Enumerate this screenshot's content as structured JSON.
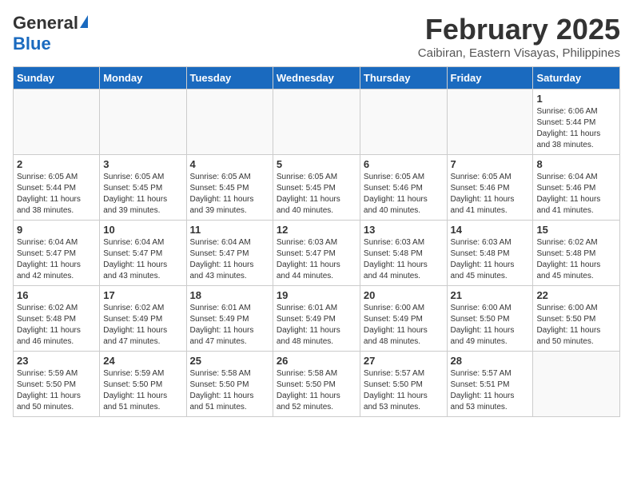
{
  "header": {
    "logo_general": "General",
    "logo_blue": "Blue",
    "month_year": "February 2025",
    "location": "Caibiran, Eastern Visayas, Philippines"
  },
  "days_of_week": [
    "Sunday",
    "Monday",
    "Tuesday",
    "Wednesday",
    "Thursday",
    "Friday",
    "Saturday"
  ],
  "weeks": [
    [
      {
        "day": "",
        "info": ""
      },
      {
        "day": "",
        "info": ""
      },
      {
        "day": "",
        "info": ""
      },
      {
        "day": "",
        "info": ""
      },
      {
        "day": "",
        "info": ""
      },
      {
        "day": "",
        "info": ""
      },
      {
        "day": "1",
        "info": "Sunrise: 6:06 AM\nSunset: 5:44 PM\nDaylight: 11 hours\nand 38 minutes."
      }
    ],
    [
      {
        "day": "2",
        "info": "Sunrise: 6:05 AM\nSunset: 5:44 PM\nDaylight: 11 hours\nand 38 minutes."
      },
      {
        "day": "3",
        "info": "Sunrise: 6:05 AM\nSunset: 5:45 PM\nDaylight: 11 hours\nand 39 minutes."
      },
      {
        "day": "4",
        "info": "Sunrise: 6:05 AM\nSunset: 5:45 PM\nDaylight: 11 hours\nand 39 minutes."
      },
      {
        "day": "5",
        "info": "Sunrise: 6:05 AM\nSunset: 5:45 PM\nDaylight: 11 hours\nand 40 minutes."
      },
      {
        "day": "6",
        "info": "Sunrise: 6:05 AM\nSunset: 5:46 PM\nDaylight: 11 hours\nand 40 minutes."
      },
      {
        "day": "7",
        "info": "Sunrise: 6:05 AM\nSunset: 5:46 PM\nDaylight: 11 hours\nand 41 minutes."
      },
      {
        "day": "8",
        "info": "Sunrise: 6:04 AM\nSunset: 5:46 PM\nDaylight: 11 hours\nand 41 minutes."
      }
    ],
    [
      {
        "day": "9",
        "info": "Sunrise: 6:04 AM\nSunset: 5:47 PM\nDaylight: 11 hours\nand 42 minutes."
      },
      {
        "day": "10",
        "info": "Sunrise: 6:04 AM\nSunset: 5:47 PM\nDaylight: 11 hours\nand 43 minutes."
      },
      {
        "day": "11",
        "info": "Sunrise: 6:04 AM\nSunset: 5:47 PM\nDaylight: 11 hours\nand 43 minutes."
      },
      {
        "day": "12",
        "info": "Sunrise: 6:03 AM\nSunset: 5:47 PM\nDaylight: 11 hours\nand 44 minutes."
      },
      {
        "day": "13",
        "info": "Sunrise: 6:03 AM\nSunset: 5:48 PM\nDaylight: 11 hours\nand 44 minutes."
      },
      {
        "day": "14",
        "info": "Sunrise: 6:03 AM\nSunset: 5:48 PM\nDaylight: 11 hours\nand 45 minutes."
      },
      {
        "day": "15",
        "info": "Sunrise: 6:02 AM\nSunset: 5:48 PM\nDaylight: 11 hours\nand 45 minutes."
      }
    ],
    [
      {
        "day": "16",
        "info": "Sunrise: 6:02 AM\nSunset: 5:48 PM\nDaylight: 11 hours\nand 46 minutes."
      },
      {
        "day": "17",
        "info": "Sunrise: 6:02 AM\nSunset: 5:49 PM\nDaylight: 11 hours\nand 47 minutes."
      },
      {
        "day": "18",
        "info": "Sunrise: 6:01 AM\nSunset: 5:49 PM\nDaylight: 11 hours\nand 47 minutes."
      },
      {
        "day": "19",
        "info": "Sunrise: 6:01 AM\nSunset: 5:49 PM\nDaylight: 11 hours\nand 48 minutes."
      },
      {
        "day": "20",
        "info": "Sunrise: 6:00 AM\nSunset: 5:49 PM\nDaylight: 11 hours\nand 48 minutes."
      },
      {
        "day": "21",
        "info": "Sunrise: 6:00 AM\nSunset: 5:50 PM\nDaylight: 11 hours\nand 49 minutes."
      },
      {
        "day": "22",
        "info": "Sunrise: 6:00 AM\nSunset: 5:50 PM\nDaylight: 11 hours\nand 50 minutes."
      }
    ],
    [
      {
        "day": "23",
        "info": "Sunrise: 5:59 AM\nSunset: 5:50 PM\nDaylight: 11 hours\nand 50 minutes."
      },
      {
        "day": "24",
        "info": "Sunrise: 5:59 AM\nSunset: 5:50 PM\nDaylight: 11 hours\nand 51 minutes."
      },
      {
        "day": "25",
        "info": "Sunrise: 5:58 AM\nSunset: 5:50 PM\nDaylight: 11 hours\nand 51 minutes."
      },
      {
        "day": "26",
        "info": "Sunrise: 5:58 AM\nSunset: 5:50 PM\nDaylight: 11 hours\nand 52 minutes."
      },
      {
        "day": "27",
        "info": "Sunrise: 5:57 AM\nSunset: 5:50 PM\nDaylight: 11 hours\nand 53 minutes."
      },
      {
        "day": "28",
        "info": "Sunrise: 5:57 AM\nSunset: 5:51 PM\nDaylight: 11 hours\nand 53 minutes."
      },
      {
        "day": "",
        "info": ""
      }
    ]
  ]
}
